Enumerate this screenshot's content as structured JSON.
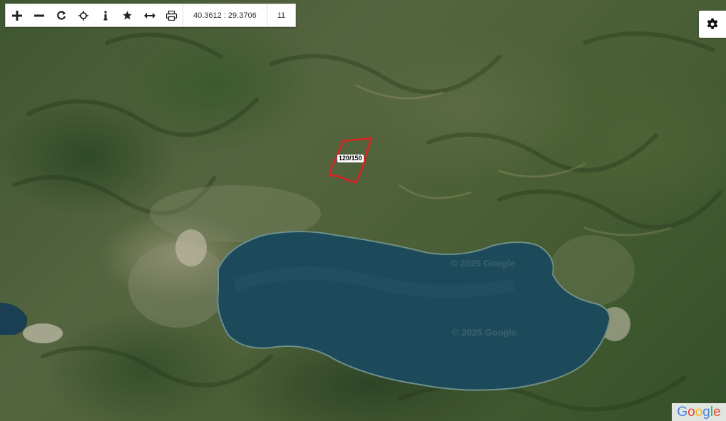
{
  "toolbar": {
    "buttons": [
      {
        "name": "zoom-in-button",
        "icon": "plus-icon"
      },
      {
        "name": "zoom-out-button",
        "icon": "minus-icon"
      },
      {
        "name": "refresh-button",
        "icon": "refresh-icon"
      },
      {
        "name": "locate-button",
        "icon": "crosshair-icon"
      },
      {
        "name": "info-button",
        "icon": "info-icon"
      },
      {
        "name": "favorite-button",
        "icon": "star-icon"
      },
      {
        "name": "measure-button",
        "icon": "arrows-horizontal-icon"
      },
      {
        "name": "print-button",
        "icon": "printer-icon"
      }
    ],
    "coordinates": "40.3612 : 29.3706",
    "zoom_level": "11"
  },
  "map": {
    "parcel_label": "120/150",
    "parcel_color": "#e02020",
    "lake_color": "#1d4a5a",
    "watermarks": [
      "© 2025 Google",
      "© 2025 Google"
    ],
    "attribution": "Google"
  },
  "settings": {
    "icon": "gear-icon"
  }
}
